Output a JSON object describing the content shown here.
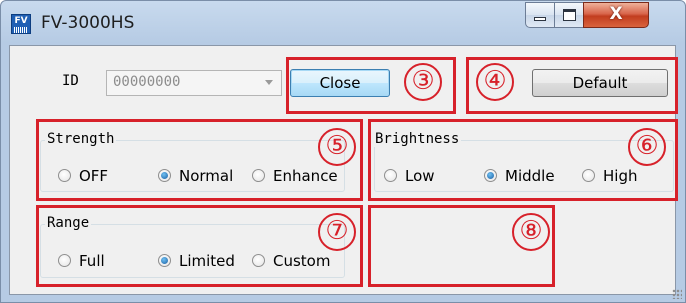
{
  "window": {
    "title": "FV-3000HS",
    "icon_text": "FV"
  },
  "titlebar_controls": {
    "close_glyph": "X"
  },
  "device": {
    "label": "ID",
    "combo_value": "00000000",
    "close_label": "Close",
    "default_label": "Default"
  },
  "strength": {
    "title": "Strength",
    "options": [
      {
        "label": "OFF",
        "checked": false
      },
      {
        "label": "Normal",
        "checked": true
      },
      {
        "label": "Enhance",
        "checked": false
      }
    ]
  },
  "brightness": {
    "title": "Brightness",
    "options": [
      {
        "label": "Low",
        "checked": false
      },
      {
        "label": "Middle",
        "checked": true
      },
      {
        "label": "High",
        "checked": false
      }
    ]
  },
  "range": {
    "title": "Range",
    "options": [
      {
        "label": "Full",
        "checked": false
      },
      {
        "label": "Limited",
        "checked": true
      },
      {
        "label": "Custom",
        "checked": false
      }
    ]
  },
  "callouts": [
    "③",
    "④",
    "⑤",
    "⑥",
    "⑦",
    "⑧"
  ],
  "colors": {
    "callout_red": "#d7212a",
    "titlebar": "#b6cbe4",
    "dialog_bg": "#f0f0f0",
    "close_button": "#c23d1f"
  }
}
